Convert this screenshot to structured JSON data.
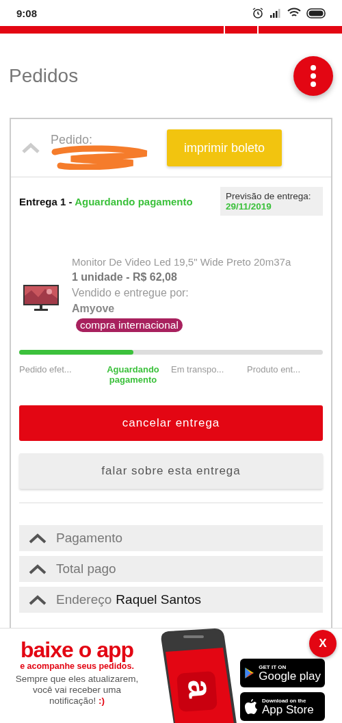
{
  "status_bar": {
    "time": "9:08"
  },
  "header": {
    "title": "Pedidos"
  },
  "order": {
    "label": "Pedido:",
    "expanded": true,
    "print_button": "imprimir boleto"
  },
  "delivery": {
    "title": "Entrega 1 - ",
    "status": "Aguardando pagamento",
    "forecast_label": "Previsão de entrega:",
    "forecast_date": "29/11/2019"
  },
  "product": {
    "name": "Monitor De Video Led 19,5\" Wide Preto 20m37a",
    "quantity_price": "1 unidade - R$ 62,08",
    "seller_label": "Vendido e entregue por:",
    "seller": "Amyove",
    "tag": "compra internacional"
  },
  "progress": {
    "level": 0.375
  },
  "steps": [
    {
      "label": "Pedido efet...",
      "selected": false
    },
    {
      "label": "Aguardando pagamento",
      "selected": true
    },
    {
      "label": "Em transpo...",
      "selected": false
    },
    {
      "label": "Produto ent...",
      "selected": false
    }
  ],
  "buttons": {
    "cancel": "cancelar entrega",
    "talk": "falar sobre esta entrega"
  },
  "sections": [
    {
      "label": "Pagamento",
      "expanded": false
    },
    {
      "label": "Total pago",
      "expanded": false
    },
    {
      "label": "Endereço",
      "value": "Raquel Santos",
      "expanded": false
    }
  ],
  "banner": {
    "headline": "baixe o app",
    "subheadline": "e acompanhe seus pedidos.",
    "body": "Sempre que eles atualizarem, você vai receber uma notificação!",
    "smiley": ":)",
    "logo_letter": "a",
    "google_small": "GET IT ON",
    "google_big": "Google play",
    "apple_small": "Download on the",
    "apple_big": "App Store",
    "close": "X"
  }
}
